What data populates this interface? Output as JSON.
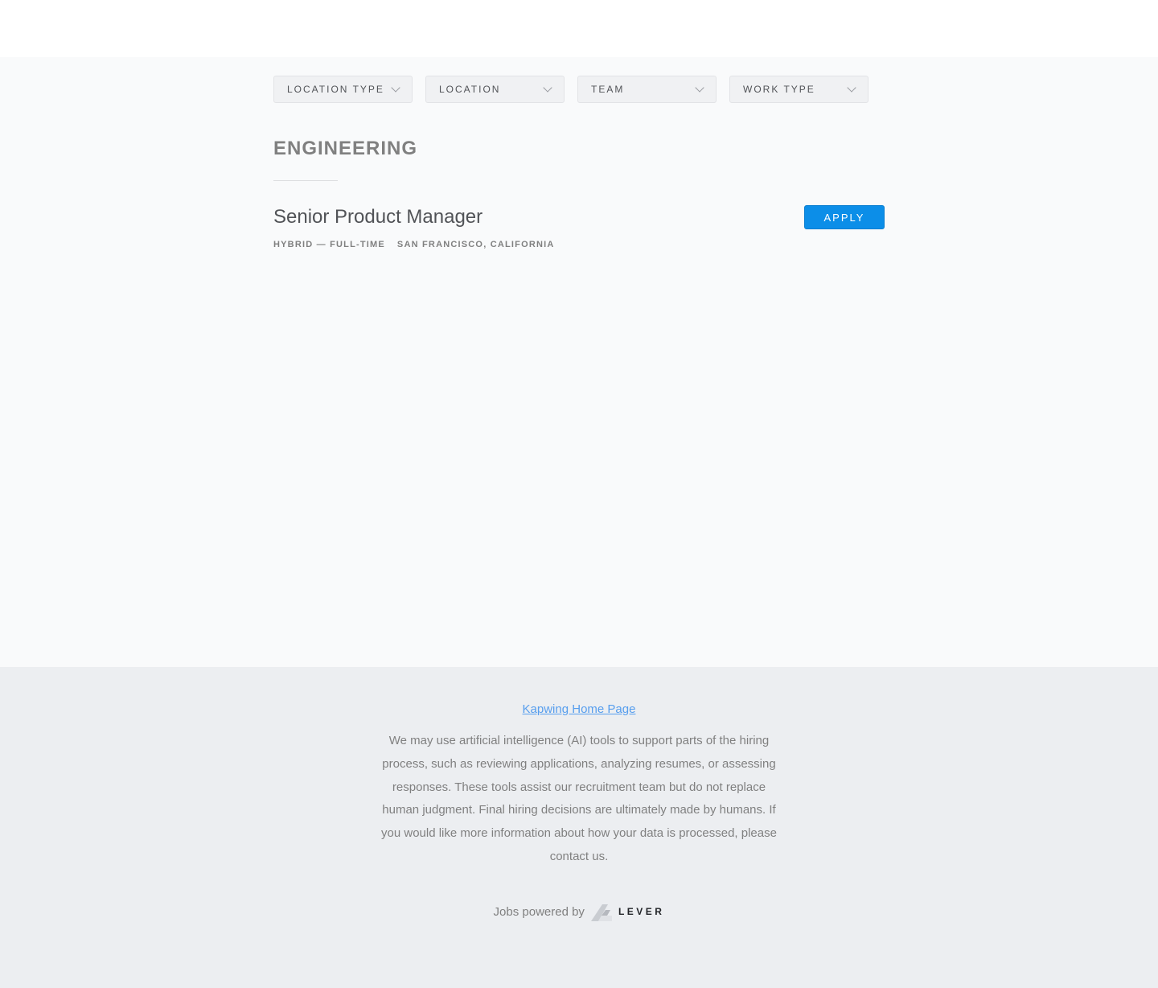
{
  "filters": [
    {
      "label": "Location type"
    },
    {
      "label": "Location"
    },
    {
      "label": "Team"
    },
    {
      "label": "Work type"
    }
  ],
  "section": {
    "title": "Engineering"
  },
  "posting": {
    "title": "Senior Product Manager",
    "commitment": "Hybrid — Full-time",
    "location": "San Francisco, California",
    "apply_label": "Apply"
  },
  "footer": {
    "home_link": "Kapwing Home Page",
    "ai_notice": "We may use artificial intelligence (AI) tools to support parts of the hiring process, such as reviewing applications, analyzing resumes, or assessing responses. These tools assist our recruitment team but do not replace human judgment. Final hiring decisions are ultimately made by humans. If you would like more information about how your data is processed, please contact us.",
    "powered_by": "Jobs powered by",
    "lever_wordmark": "LEVER"
  },
  "colors": {
    "apply_button": "#0c8ee8",
    "link": "#579eee",
    "footer_bg": "#eceef1",
    "page_bg": "#f9fafb"
  }
}
